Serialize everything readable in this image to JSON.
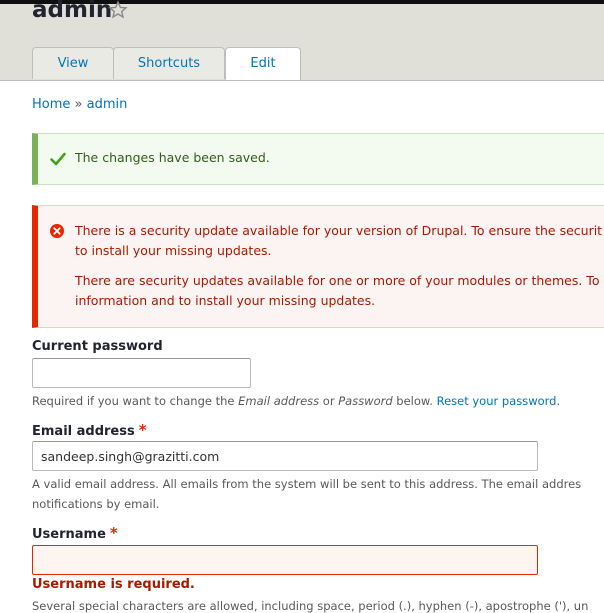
{
  "header": {
    "title": "admin",
    "star_icon": "star-outline-icon"
  },
  "tabs": [
    {
      "label": "View"
    },
    {
      "label": "Shortcuts"
    },
    {
      "label": "Edit",
      "active": true
    }
  ],
  "breadcrumb": {
    "home": "Home",
    "separator": "»",
    "current": "admin"
  },
  "messages": {
    "status": "The changes have been saved.",
    "error_lines": [
      "There is a security update available for your version of Drupal. To ensure the securit",
      "to install your missing updates.",
      "There are security updates available for one or more of your modules or themes. To",
      "information and to install your missing updates."
    ]
  },
  "form": {
    "current_password": {
      "label": "Current password",
      "value": "",
      "desc_pre": "Required if you want to change the ",
      "desc_em1": "Email address",
      "desc_mid": " or ",
      "desc_em2": "Password",
      "desc_post": " below. ",
      "desc_link": "Reset your password",
      "desc_end": "."
    },
    "email": {
      "label": "Email address",
      "required_mark": "*",
      "value": "sandeep.singh@grazitti.com",
      "desc_line1": "A valid email address. All emails from the system will be sent to this address. The email addres",
      "desc_line2": "notifications by email."
    },
    "username": {
      "label": "Username",
      "required_mark": "*",
      "value": "",
      "error": "Username is required.",
      "desc": "Several special characters are allowed, including space, period (.), hyphen (-), apostrophe ('), un"
    }
  },
  "colors": {
    "link": "#0074bd",
    "status_accent": "#77b259",
    "error_accent": "#e62600"
  }
}
